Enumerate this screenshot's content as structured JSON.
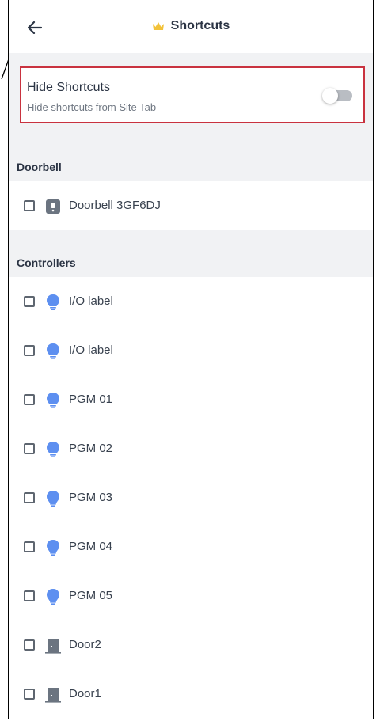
{
  "header": {
    "title": "Shortcuts"
  },
  "hide_shortcuts": {
    "title": "Hide Shortcuts",
    "subtitle": "Hide shortcuts from Site Tab",
    "enabled": false
  },
  "doorbell_section": {
    "heading": "Doorbell",
    "items": [
      {
        "label": "Doorbell 3GF6DJ",
        "icon": "doorbell-icon",
        "checked": false
      }
    ]
  },
  "controllers_section": {
    "heading": "Controllers",
    "items": [
      {
        "label": "I/O label",
        "icon": "bulb-icon",
        "checked": false
      },
      {
        "label": "I/O label",
        "icon": "bulb-icon",
        "checked": false
      },
      {
        "label": "PGM 01",
        "icon": "bulb-icon",
        "checked": false
      },
      {
        "label": "PGM 02",
        "icon": "bulb-icon",
        "checked": false
      },
      {
        "label": "PGM 03",
        "icon": "bulb-icon",
        "checked": false
      },
      {
        "label": "PGM 04",
        "icon": "bulb-icon",
        "checked": false
      },
      {
        "label": "PGM 05",
        "icon": "bulb-icon",
        "checked": false
      },
      {
        "label": "Door2",
        "icon": "door-icon",
        "checked": false
      },
      {
        "label": "Door1",
        "icon": "door-icon",
        "checked": false
      }
    ]
  },
  "colors": {
    "accent_red": "#c9323f",
    "bulb_blue": "#5d8ff0",
    "door_gray": "#6b7480",
    "crown_yellow": "#f2c23a"
  }
}
